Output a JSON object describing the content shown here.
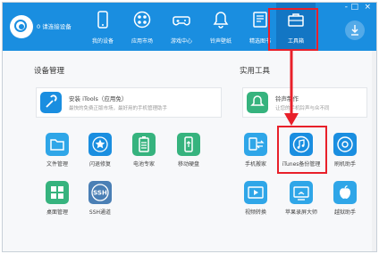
{
  "app": {
    "device_status": "0 请连接设备",
    "nav": [
      {
        "label": "我的设备",
        "icon": "phone-icon"
      },
      {
        "label": "应用市场",
        "icon": "apps-icon"
      },
      {
        "label": "游戏中心",
        "icon": "gamepad-icon"
      },
      {
        "label": "铃声壁纸",
        "icon": "bell-icon"
      },
      {
        "label": "精选图书",
        "icon": "book-icon"
      },
      {
        "label": "工具箱",
        "icon": "toolbox-icon"
      }
    ],
    "window_buttons": [
      "-",
      "□",
      "×"
    ]
  },
  "device_management": {
    "title": "设备管理",
    "banner": {
      "title": "安装 iTools（应用免）",
      "desc": "最快的免费正版市场，最好用的手机管理助手"
    },
    "tools": [
      {
        "label": "文件管理",
        "color": "#2fa6e8",
        "icon": "folder-icon"
      },
      {
        "label": "闪退修复",
        "color": "#1a8ee0",
        "icon": "star-icon"
      },
      {
        "label": "电池专家",
        "color": "#36b37e",
        "icon": "battery-icon"
      },
      {
        "label": "移动硬盘",
        "color": "#36b37e",
        "icon": "usb-icon"
      },
      {
        "label": "桌面管理",
        "color": "#36b37e",
        "icon": "desktop-grid-icon"
      },
      {
        "label": "SSH通道",
        "color": "#4a7fb5",
        "icon": "ssh-icon"
      }
    ]
  },
  "utility_tools": {
    "title": "实用工具",
    "banner": {
      "title": "铃声制作",
      "desc": "让您的手机铃声与众不同"
    },
    "tools": [
      {
        "label": "手机搬家",
        "color": "#2fa6e8",
        "icon": "phone-transfer-icon"
      },
      {
        "label": "iTunes备份管理",
        "color": "#1a8ee0",
        "icon": "itunes-icon"
      },
      {
        "label": "刷机助手",
        "color": "#1a8ee0",
        "icon": "flash-icon"
      },
      {
        "label": "视频转换",
        "color": "#2fa6e8",
        "icon": "video-icon"
      },
      {
        "label": "苹果录屏大师",
        "color": "#2fa6e8",
        "icon": "screen-record-icon"
      },
      {
        "label": "越狱助手",
        "color": "#2fa6e8",
        "icon": "apple-icon"
      }
    ]
  }
}
